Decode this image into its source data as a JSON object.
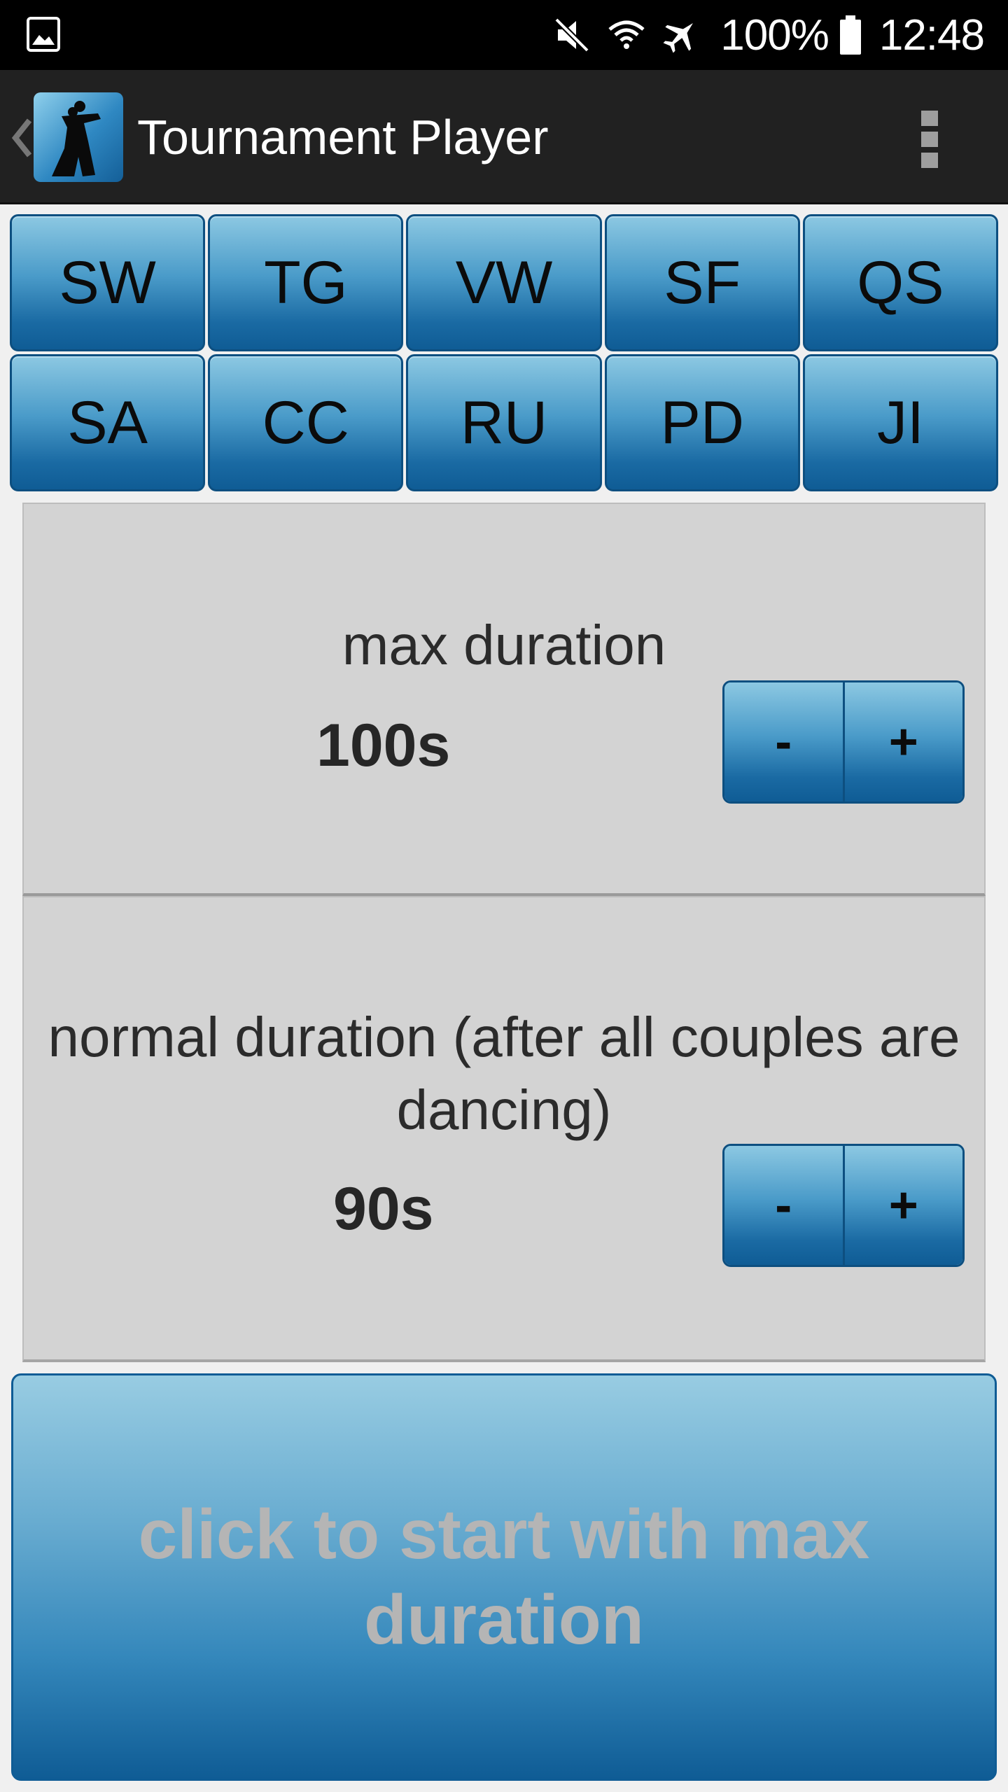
{
  "status_bar": {
    "battery_percent": "100%",
    "time": "12:48",
    "icons": [
      "gallery-notification-icon",
      "mute-icon",
      "wifi-icon",
      "airplane-icon",
      "battery-icon"
    ]
  },
  "action_bar": {
    "title": "Tournament Player",
    "icons": [
      "back-chevron-icon",
      "dancer-app-icon",
      "overflow-menu-icon"
    ]
  },
  "dances": {
    "row1": [
      "SW",
      "TG",
      "VW",
      "SF",
      "QS"
    ],
    "row2": [
      "SA",
      "CC",
      "RU",
      "PD",
      "JI"
    ]
  },
  "max_duration": {
    "label": "max duration",
    "value": "100s",
    "minus": "-",
    "plus": "+"
  },
  "normal_duration": {
    "label": "normal duration (after all couples are dancing)",
    "value": "90s",
    "minus": "-",
    "plus": "+"
  },
  "start_button": {
    "label": "click to start with max duration"
  },
  "colors": {
    "button_blue": "#1a6aa3",
    "panel_gray": "#d3d3d3",
    "disabled_text": "#b5b5b5"
  }
}
